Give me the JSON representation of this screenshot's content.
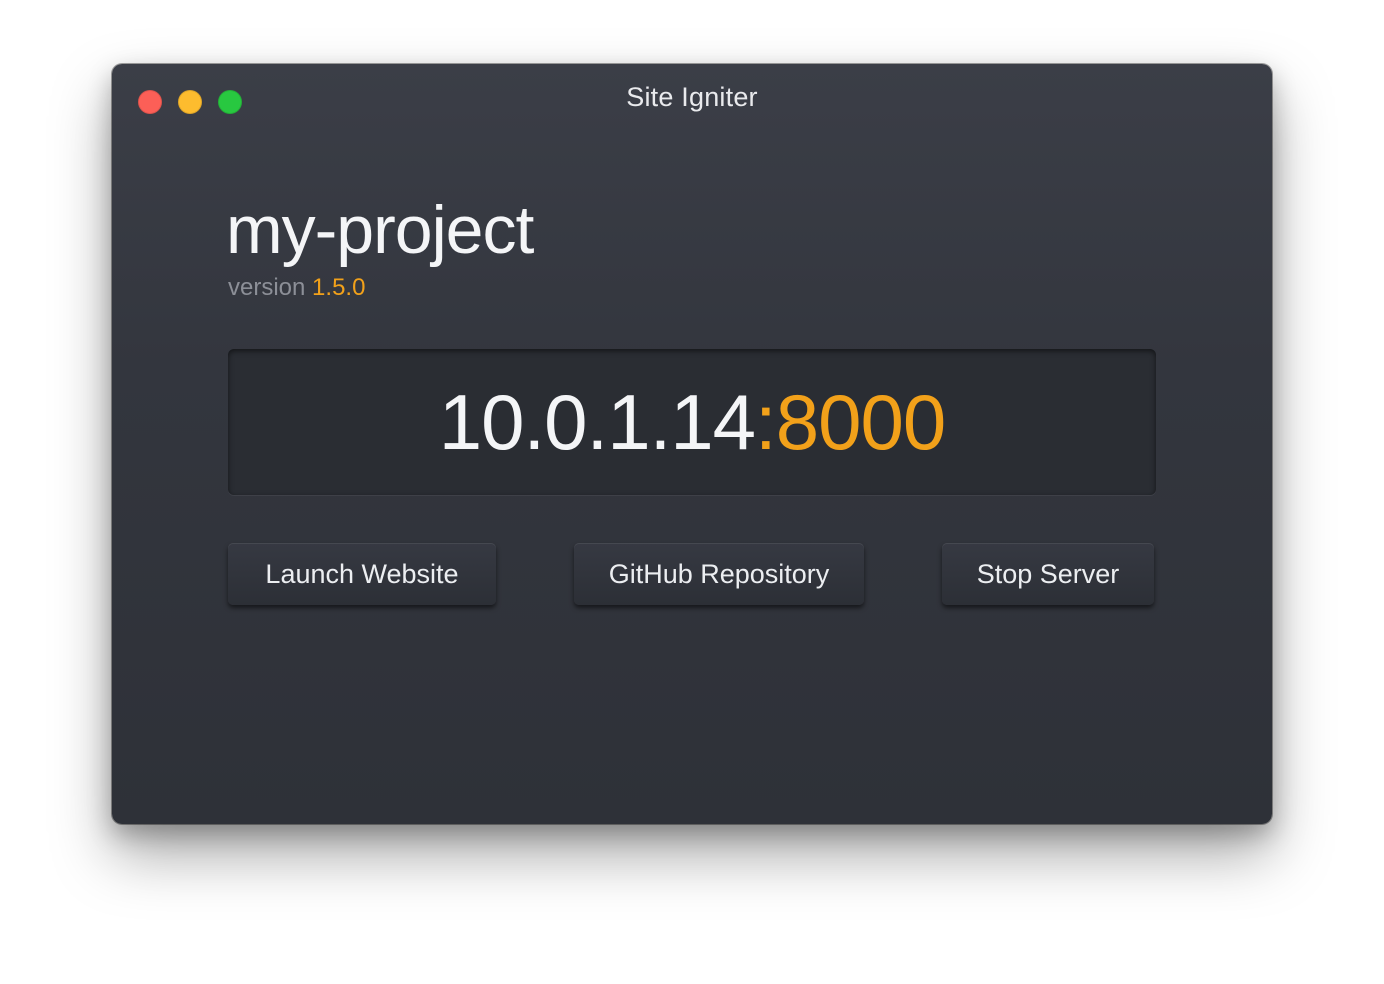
{
  "window": {
    "title": "Site Igniter"
  },
  "project": {
    "name": "my-project",
    "version_label": "version",
    "version": "1.5.0"
  },
  "server": {
    "ip": "10.0.1.14",
    "separator": ":",
    "port": "8000"
  },
  "actions": {
    "launch_label": "Launch Website",
    "github_label": "GitHub Repository",
    "stop_label": "Stop Server"
  },
  "colors": {
    "accent": "#f2a11a",
    "window_bg": "#33363e",
    "close": "#fc5f57",
    "minimize": "#fdbc2e",
    "zoom": "#28c840"
  }
}
